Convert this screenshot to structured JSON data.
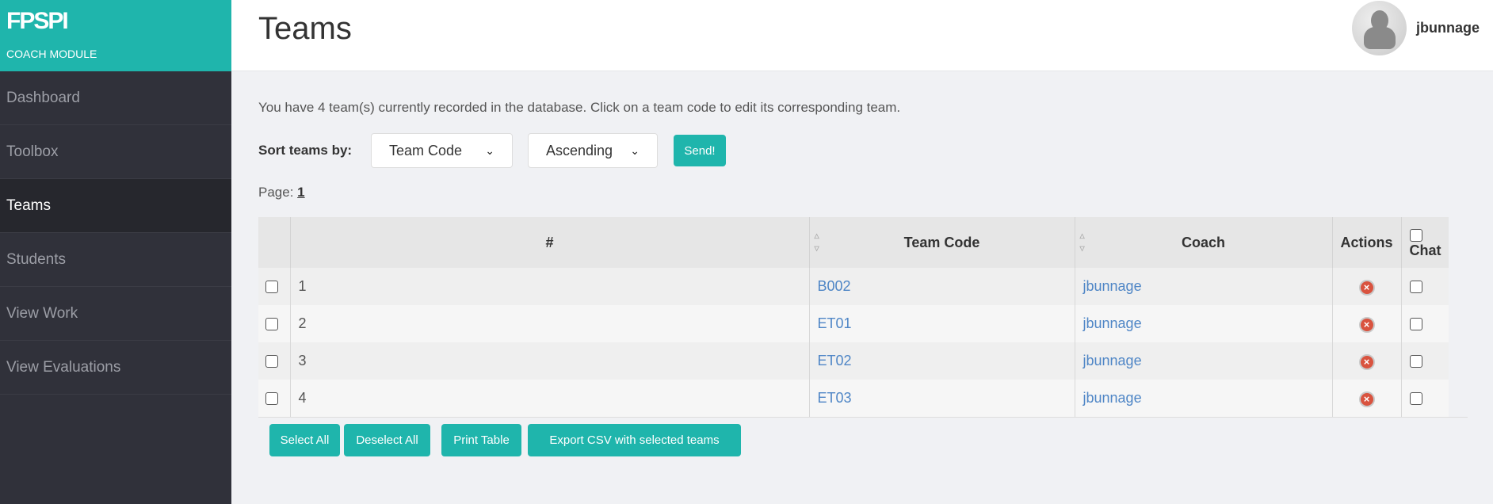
{
  "brand": {
    "logo": "FPSPI",
    "subtitle": "COACH MODULE"
  },
  "sidebar": {
    "items": [
      {
        "label": "Dashboard"
      },
      {
        "label": "Toolbox"
      },
      {
        "label": "Teams",
        "active": true
      },
      {
        "label": "Students"
      },
      {
        "label": "View Work"
      },
      {
        "label": "View Evaluations"
      }
    ]
  },
  "header": {
    "title": "Teams",
    "username": "jbunnage"
  },
  "intro": "You have 4 team(s) currently recorded in the database. Click on a team code to edit its corresponding team.",
  "sort": {
    "label": "Sort teams by:",
    "field": "Team Code",
    "order": "Ascending",
    "send": "Send!"
  },
  "pagination": {
    "label": "Page:",
    "current": "1"
  },
  "table": {
    "headers": {
      "num": "#",
      "team_code": "Team Code",
      "coach": "Coach",
      "actions": "Actions",
      "chat": "Chat"
    },
    "rows": [
      {
        "num": "1",
        "team_code": "B002",
        "coach": "jbunnage"
      },
      {
        "num": "2",
        "team_code": "ET01",
        "coach": "jbunnage"
      },
      {
        "num": "3",
        "team_code": "ET02",
        "coach": "jbunnage"
      },
      {
        "num": "4",
        "team_code": "ET03",
        "coach": "jbunnage"
      }
    ]
  },
  "buttons": {
    "select_all": "Select All",
    "deselect_all": "Deselect All",
    "print": "Print Table",
    "export": "Export CSV with selected teams"
  },
  "colors": {
    "accent": "#1fb5ac",
    "sidebar": "#30313a",
    "link": "#4f86c6"
  }
}
